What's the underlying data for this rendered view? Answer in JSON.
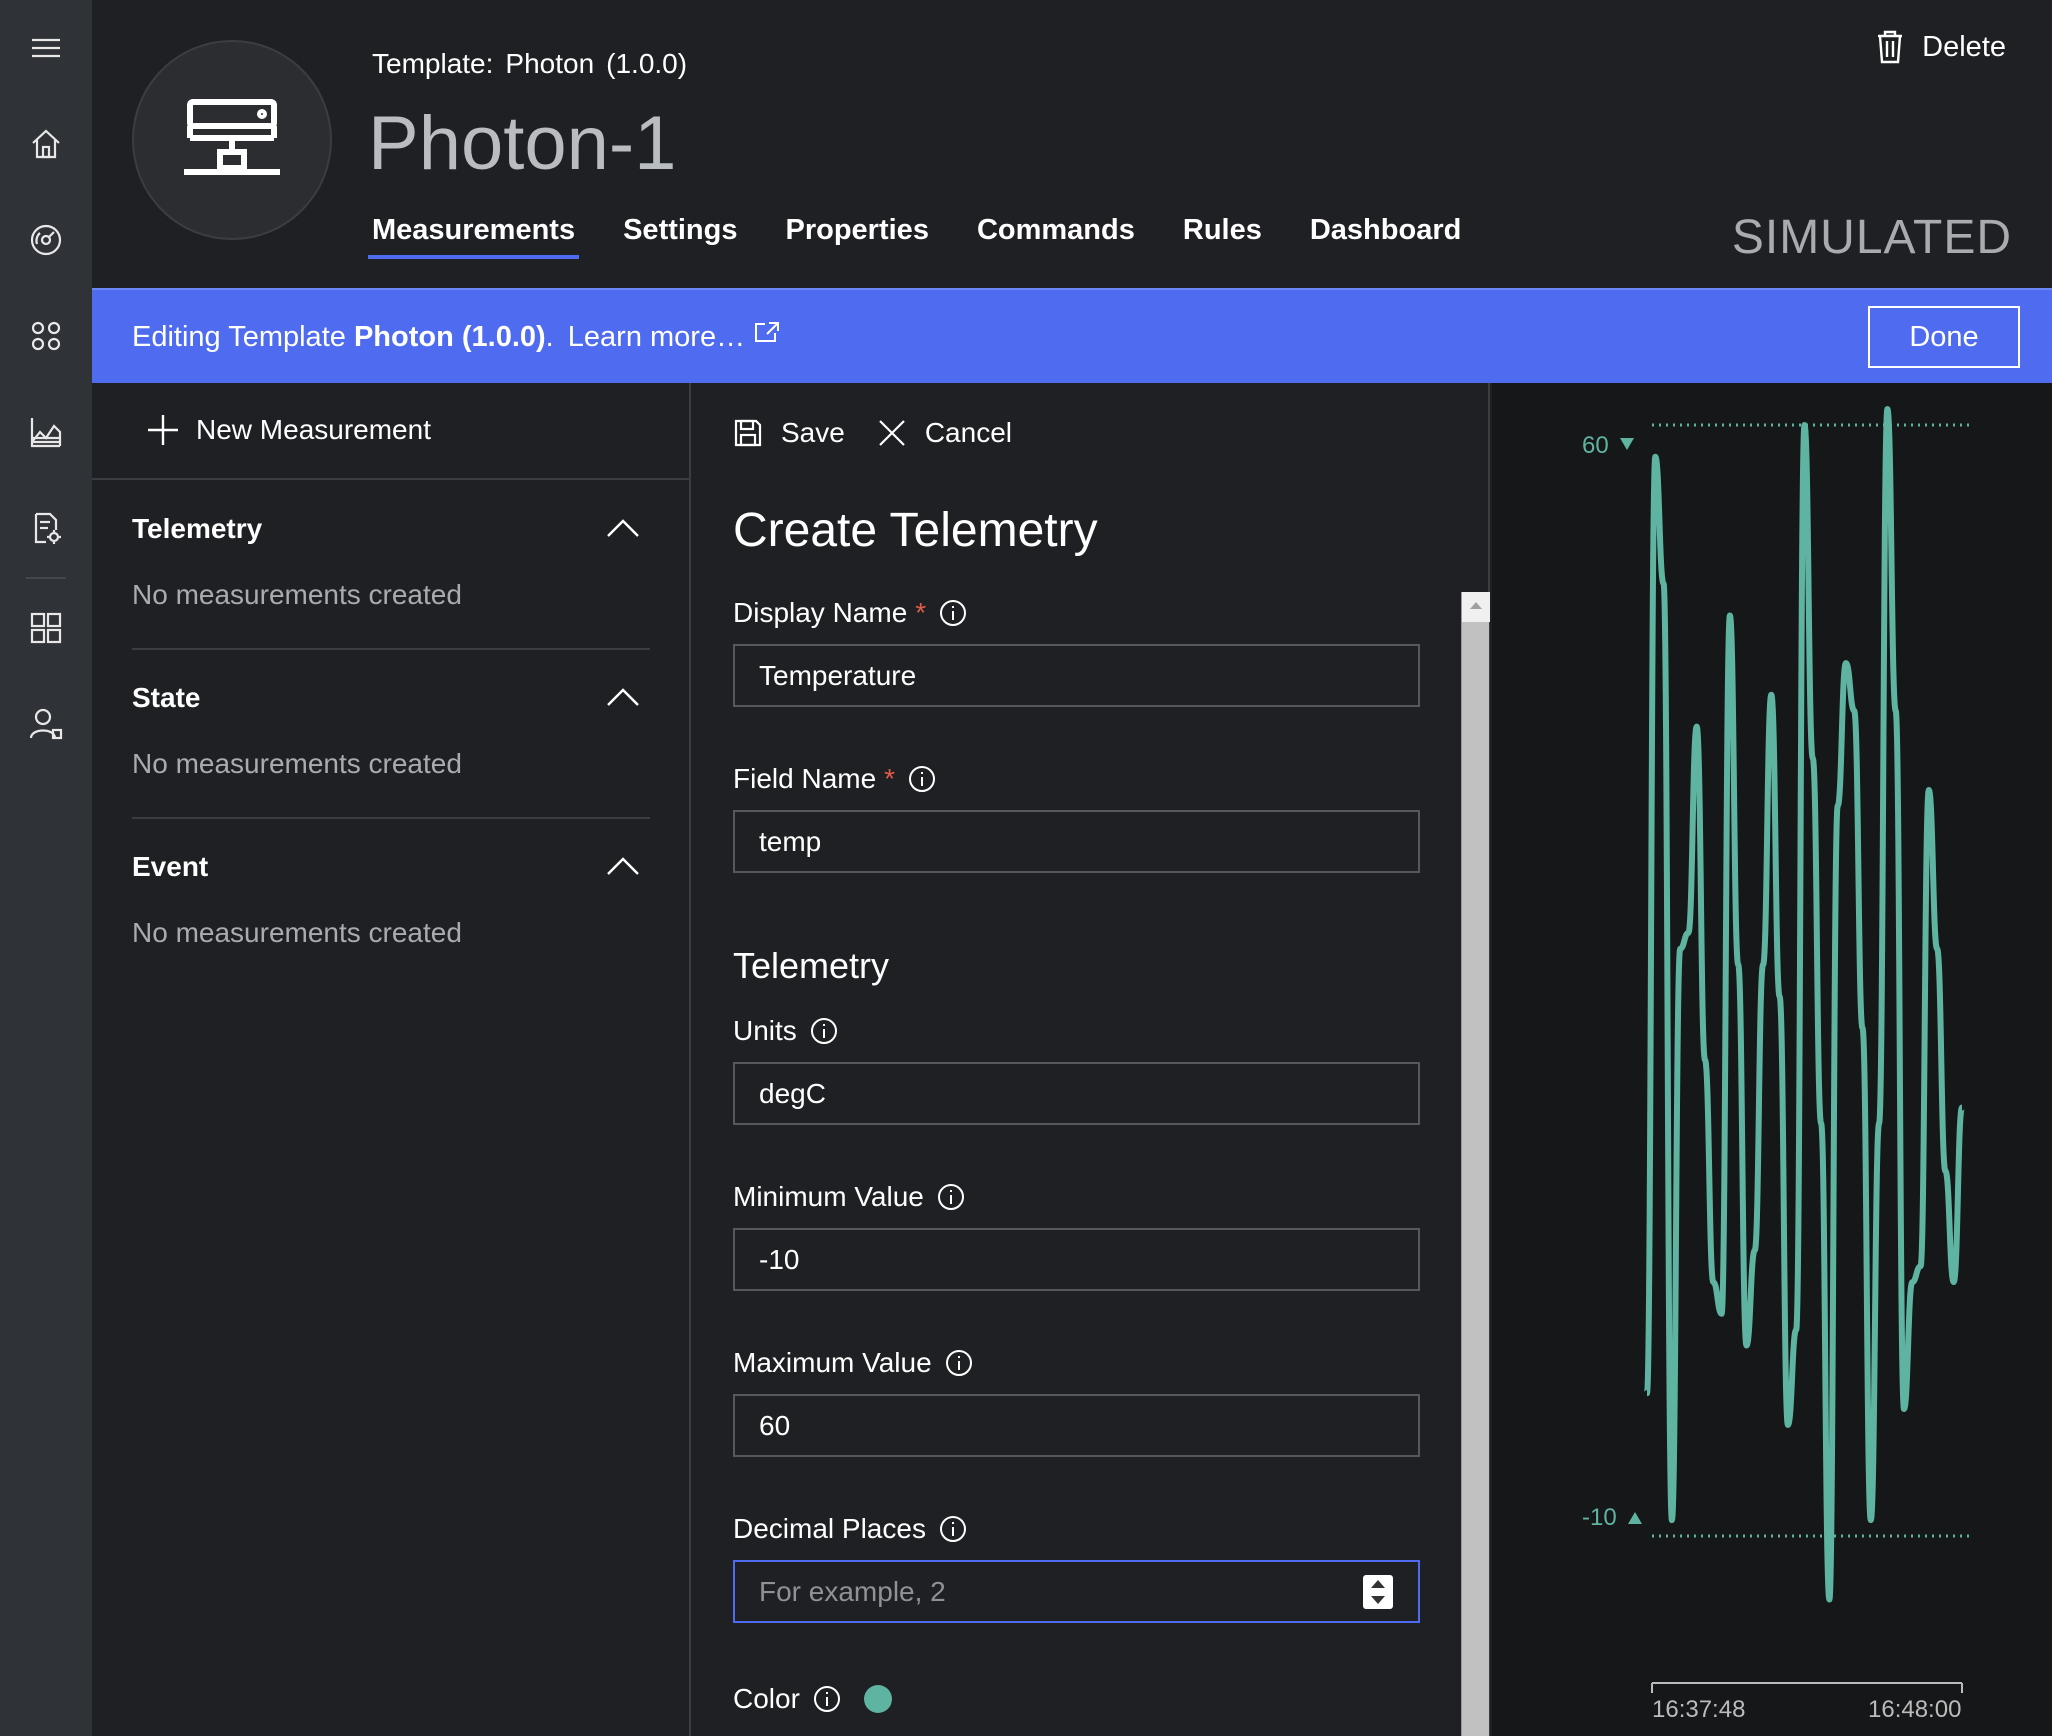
{
  "nav": {
    "items": [
      {
        "name": "menu-icon",
        "y": 48
      },
      {
        "name": "home-icon",
        "y": 144
      },
      {
        "name": "explorer-icon",
        "y": 240
      },
      {
        "name": "device-sets-icon",
        "y": 336
      },
      {
        "name": "analytics-icon",
        "y": 432
      },
      {
        "name": "jobs-icon",
        "y": 528
      },
      {
        "name": "app-builder-icon",
        "y": 628
      },
      {
        "name": "administration-icon",
        "y": 724
      }
    ]
  },
  "header": {
    "template_label": "Template:",
    "template_name": "Photon",
    "template_version": "(1.0.0)",
    "device_name": "Photon-1",
    "delete_label": "Delete",
    "status": "SIMULATED",
    "tabs": [
      {
        "label": "Measurements",
        "active": true
      },
      {
        "label": "Settings"
      },
      {
        "label": "Properties"
      },
      {
        "label": "Commands"
      },
      {
        "label": "Rules"
      },
      {
        "label": "Dashboard"
      }
    ]
  },
  "banner": {
    "prefix": "Editing Template ",
    "template": "Photon (1.0.0)",
    "dot": ".",
    "learn_more": "Learn more…",
    "done_label": "Done"
  },
  "measurements": {
    "new_label": "New Measurement",
    "sections": [
      {
        "title": "Telemetry",
        "empty": "No measurements created"
      },
      {
        "title": "State",
        "empty": "No measurements created"
      },
      {
        "title": "Event",
        "empty": "No measurements created"
      }
    ]
  },
  "form": {
    "save_label": "Save",
    "cancel_label": "Cancel",
    "title": "Create Telemetry",
    "display_name": {
      "label": "Display Name",
      "required": "*",
      "value": "Temperature"
    },
    "field_name": {
      "label": "Field Name",
      "required": "*",
      "value": "temp"
    },
    "section_heading": "Telemetry",
    "units": {
      "label": "Units",
      "value": "degC"
    },
    "min_value": {
      "label": "Minimum Value",
      "value": "-10"
    },
    "max_value": {
      "label": "Maximum Value",
      "value": "60"
    },
    "decimal_places": {
      "label": "Decimal Places",
      "value": "",
      "placeholder": "For example, 2"
    },
    "color": {
      "label": "Color",
      "value": "#5fb3a1"
    }
  },
  "chart_data": {
    "type": "line",
    "color": "#5fb3a1",
    "ylim": [
      -10,
      60
    ],
    "max_label": "60",
    "min_label": "-10",
    "x_tick_labels": [
      "16:37:48",
      "16:48:00"
    ],
    "values": [
      -1,
      58,
      50,
      -9,
      27,
      28,
      41,
      20,
      6,
      4,
      48,
      26,
      2,
      8,
      26,
      43,
      24,
      -3,
      3,
      60,
      39,
      16,
      -14,
      36,
      45,
      42,
      22,
      -9,
      16,
      61,
      42,
      -2,
      6,
      7,
      37,
      27,
      13,
      6,
      17
    ]
  }
}
